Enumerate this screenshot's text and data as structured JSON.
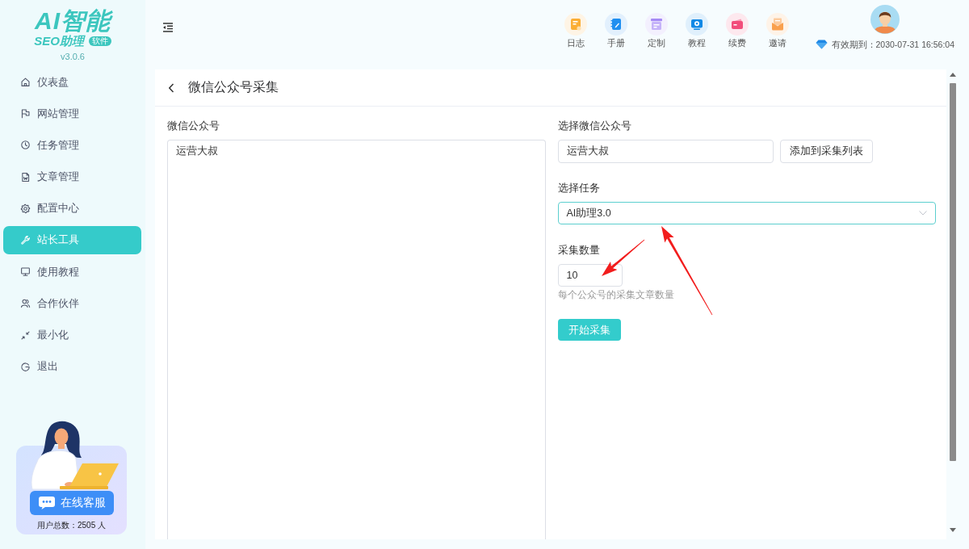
{
  "sidebar": {
    "logo": {
      "title": "AI智能",
      "subtitle": "SEO助理",
      "badge": "软件"
    },
    "version": "v3.0.6",
    "items": [
      {
        "label": "仪表盘",
        "selected": false
      },
      {
        "label": "网站管理",
        "selected": false
      },
      {
        "label": "任务管理",
        "selected": false
      },
      {
        "label": "文章管理",
        "selected": false
      },
      {
        "label": "配置中心",
        "selected": false
      },
      {
        "label": "站长工具",
        "selected": true
      },
      {
        "label": "使用教程",
        "selected": false
      },
      {
        "label": "合作伙伴",
        "selected": false
      },
      {
        "label": "最小化",
        "selected": false
      },
      {
        "label": "退出",
        "selected": false
      }
    ],
    "support": {
      "button": "在线客服",
      "user_count": "用户总数：2505 人"
    }
  },
  "header": {
    "toolbar": [
      {
        "label": "日志",
        "color": "#fbae35"
      },
      {
        "label": "手册",
        "color": "#1f8ff0"
      },
      {
        "label": "定制",
        "color": "#a68af5"
      },
      {
        "label": "教程",
        "color": "#1289e6"
      },
      {
        "label": "续费",
        "color": "#f24d7b"
      },
      {
        "label": "邀请",
        "color": "#f9a04e"
      }
    ],
    "expiry": "有效期到：2030-07-31 16:56:04"
  },
  "page": {
    "title": "微信公众号采集",
    "accounts": {
      "label": "微信公众号",
      "value": "运营大叔"
    },
    "select_account": {
      "label": "选择微信公众号",
      "value": "运营大叔",
      "button": "添加到采集列表"
    },
    "task": {
      "label": "选择任务",
      "value": "AI助理3.0",
      "focused": true
    },
    "count": {
      "label": "采集数量",
      "value": "10",
      "hint": "每个公众号的采集文章数量"
    },
    "start_button": "开始采集"
  }
}
